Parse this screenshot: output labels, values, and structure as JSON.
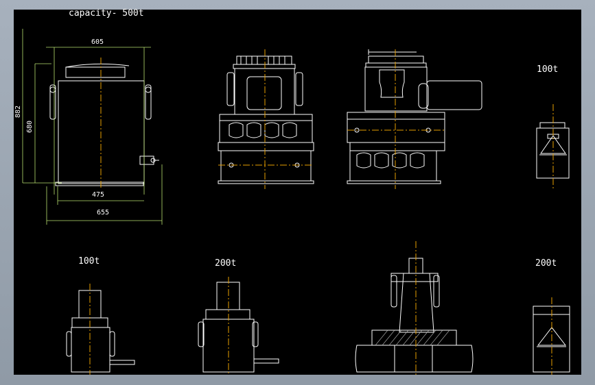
{
  "title": "capacity- 500t",
  "dimensions": {
    "top_width": "605",
    "height_total": "882",
    "height_body": "680",
    "base_inner": "475",
    "base_outer": "655"
  },
  "labels": {
    "side_100t_right": "100t",
    "bottom_100t": "100t",
    "bottom_200t": "200t",
    "side_200t_right": "200t"
  },
  "colors": {
    "background": "#000000",
    "linework": "#ffffff",
    "centerline": "#e8a000",
    "frame": "#9aa6b3"
  }
}
